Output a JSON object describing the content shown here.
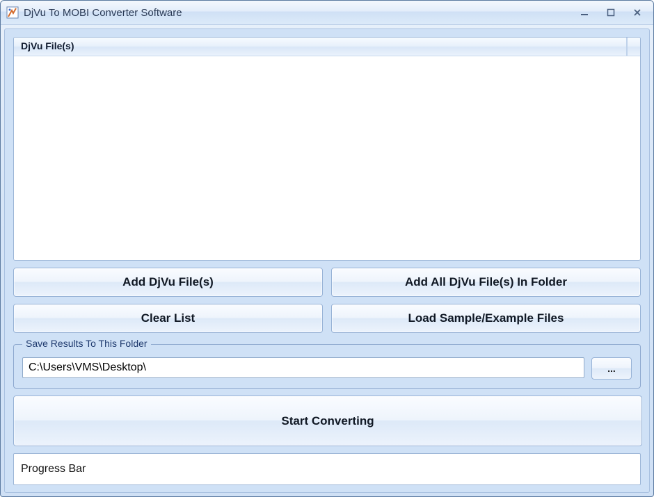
{
  "window": {
    "title": "DjVu To MOBI Converter Software"
  },
  "file_list": {
    "header": "DjVu File(s)",
    "items": []
  },
  "buttons": {
    "add_files": "Add DjVu File(s)",
    "add_folder": "Add All DjVu File(s) In Folder",
    "clear_list": "Clear List",
    "load_sample": "Load Sample/Example Files",
    "start": "Start Converting",
    "browse": "..."
  },
  "save_group": {
    "legend": "Save Results To This Folder",
    "path": "C:\\Users\\VMS\\Desktop\\"
  },
  "progress": {
    "label": "Progress Bar"
  }
}
